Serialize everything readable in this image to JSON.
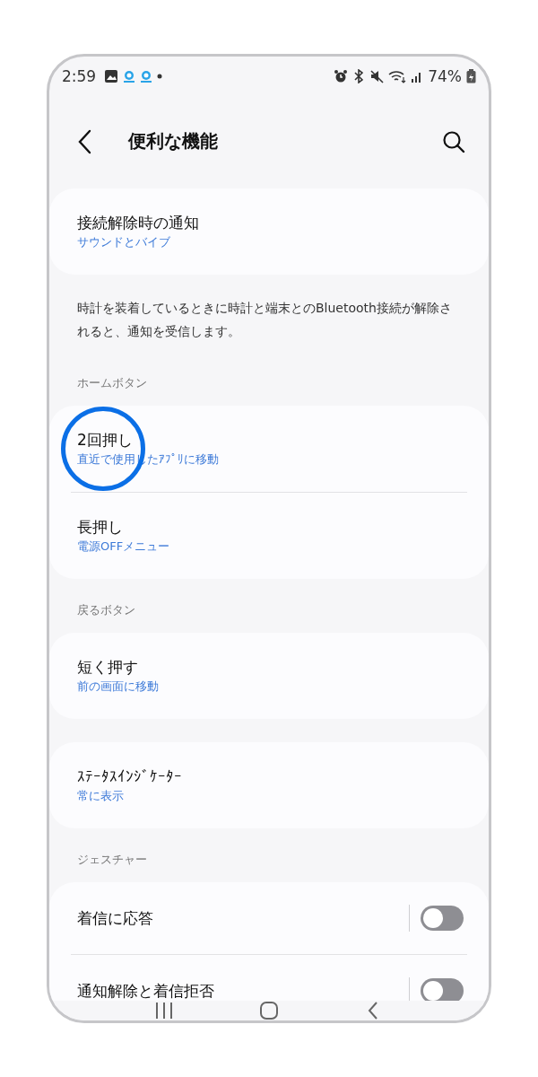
{
  "status_bar": {
    "time": "2:59",
    "battery": "74%"
  },
  "header": {
    "title": "便利な機能"
  },
  "blocks": [
    {
      "kind": "card",
      "items": [
        {
          "kind": "link",
          "title": "接続解除時の通知",
          "subtitle": "サウンドとバイブ"
        }
      ]
    },
    {
      "kind": "note",
      "text": "時計を装着しているときに時計と端末とのBluetooth接続が解除されると、通知を受信します。"
    },
    {
      "kind": "label",
      "text": "ホームボタン"
    },
    {
      "kind": "card",
      "items": [
        {
          "kind": "link",
          "title": "2回押し",
          "subtitle": "直近で使用したｱﾌﾟﾘに移動",
          "circled": true
        },
        {
          "kind": "link",
          "title": "長押し",
          "subtitle": "電源OFFメニュー"
        }
      ]
    },
    {
      "kind": "label",
      "text": "戻るボタン"
    },
    {
      "kind": "card",
      "items": [
        {
          "kind": "link",
          "title": "短く押す",
          "subtitle": "前の画面に移動"
        }
      ]
    },
    {
      "kind": "card",
      "items": [
        {
          "kind": "link",
          "title": "ｽﾃｰﾀｽｲﾝｼﾞｹｰﾀｰ",
          "subtitle": "常に表示"
        }
      ]
    },
    {
      "kind": "label",
      "text": "ジェスチャー"
    },
    {
      "kind": "card",
      "items": [
        {
          "kind": "toggle",
          "title": "着信に応答",
          "on": false
        },
        {
          "kind": "toggle",
          "title": "通知解除と着信拒否",
          "on": false
        }
      ]
    }
  ]
}
